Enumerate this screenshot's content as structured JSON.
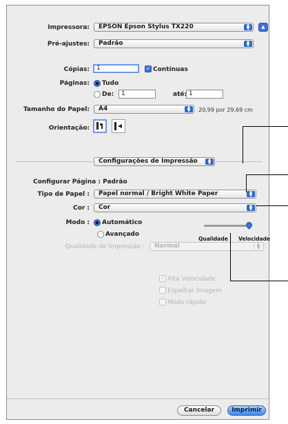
{
  "printer": {
    "label": "Impressora:",
    "value": "EPSON Epson Stylus TX220"
  },
  "presets": {
    "label": "Pré-ajustes:",
    "value": "Padrão"
  },
  "copies": {
    "label": "Cópias:",
    "value": "1",
    "collate_label": "Contínuas",
    "collate_checked": true
  },
  "pages": {
    "label": "Páginas:",
    "all_label": "Tudo",
    "from_label": "De:",
    "from_value": "1",
    "to_label": "até:",
    "to_value": "1"
  },
  "paper_size": {
    "label": "Tamanho do Papel:",
    "value": "A4",
    "dimensions": "20,99 por 29,69 cm"
  },
  "orientation": {
    "label": "Orientação:"
  },
  "panel_menu": {
    "value": "Configurações de Impressão"
  },
  "page_setup": {
    "label": "Configurar Página : Padrão"
  },
  "paper_type": {
    "label": "Tipo de Papel :",
    "value": "Papel normal / Bright White Paper"
  },
  "color": {
    "label": "Cor :",
    "value": "Cor"
  },
  "mode": {
    "label": "Modo :",
    "auto_label": "Automático",
    "advanced_label": "Avançado",
    "quality_label": "Qualidade",
    "speed_label": "Velocidade",
    "slider_fraction": 1.0
  },
  "print_quality": {
    "label": "Qualidade de Impressão :",
    "value": "Normal",
    "high_speed_label": "Alta Velocidade",
    "mirror_label": "Espelhar Imagem",
    "draft_label": "Modo rápido"
  },
  "buttons": {
    "cancel": "Cancelar",
    "print": "Imprimir"
  },
  "colors": {
    "accent": "#3a72d6",
    "panel": "#ececec"
  }
}
